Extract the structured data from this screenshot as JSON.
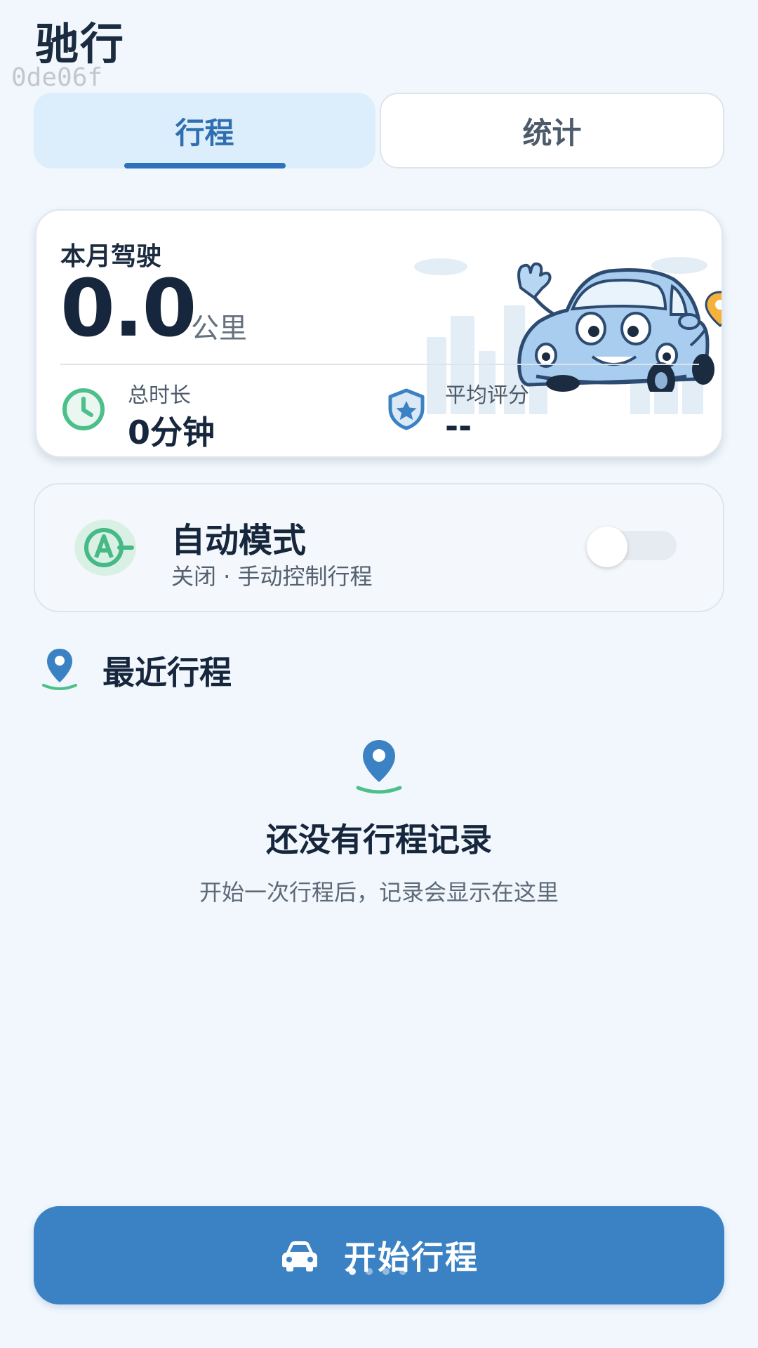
{
  "app": {
    "title": "驰行",
    "build_id": "0de06f"
  },
  "tabs": [
    {
      "label": "行程",
      "active": true
    },
    {
      "label": "统计",
      "active": false
    }
  ],
  "summary": {
    "label": "本月驾驶",
    "distance_value": "0.0",
    "distance_unit": "公里",
    "duration": {
      "label": "总时长",
      "value": "0分钟",
      "icon": "clock-icon"
    },
    "rating": {
      "label": "平均评分",
      "value": "--",
      "icon": "shield-star-icon"
    },
    "illustration": "car-mascot"
  },
  "auto_mode": {
    "title": "自动模式",
    "subtitle": "关闭 · 手动控制行程",
    "enabled": false,
    "icon": "auto-mode-icon"
  },
  "recent": {
    "title": "最近行程",
    "icon": "location-pin-icon",
    "empty_title": "还没有行程记录",
    "empty_subtitle": "开始一次行程后，记录会显示在这里"
  },
  "start_button": {
    "label": "开始行程",
    "icon": "car-icon"
  },
  "colors": {
    "background": "#f1f7fd",
    "primary": "#3b82c4",
    "accent_green": "#4cbf8a",
    "text_dark": "#16263c"
  }
}
